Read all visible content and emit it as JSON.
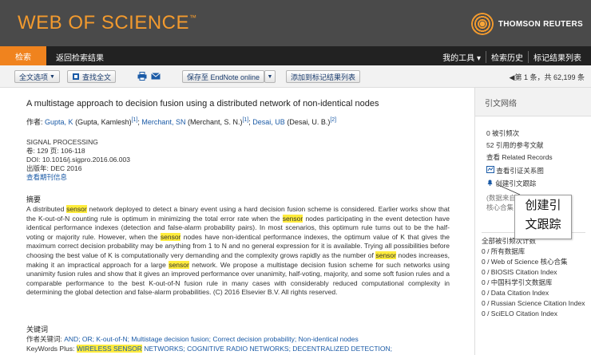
{
  "header": {
    "logo": "WEB OF SCIENCE",
    "logo_tm": "™",
    "publisher": "THOMSON REUTERS"
  },
  "nav": {
    "search": "检索",
    "back": "返回检索结果",
    "right": [
      "我的工具 ▾",
      "检索历史",
      "标记结果列表"
    ]
  },
  "toolbar": {
    "full_text_options": "全文选项",
    "find_full_text": "查找全文",
    "save_to": "保存至 EndNote online",
    "add_to_marked": "添加到标记结果列表",
    "hit_info": "◀第 1 条，共 62,199 条"
  },
  "record": {
    "title": "A multistage approach to decision fusion using a distributed network of non-identical nodes",
    "authors_label": "作者:",
    "authors": [
      {
        "link": "Gupta, K",
        "full": "(Gupta, Kamlesh)",
        "ref": "[1]"
      },
      {
        "link": "Merchant, SN",
        "full": "(Merchant, S. N.)",
        "ref": "[1]"
      },
      {
        "link": "Desai, UB",
        "full": "(Desai, U. B.)",
        "ref": "[2]"
      }
    ],
    "journal": "SIGNAL PROCESSING",
    "volume_pages": "卷: 129  页: 106-118",
    "doi": "DOI: 10.1016/j.sigpro.2016.06.003",
    "pub_date": "出版年: DEC 2016",
    "journal_info_link": "查看期刊信息",
    "abstract_heading": "摘要",
    "abstract_parts": [
      {
        "t": "A distributed "
      },
      {
        "t": "sensor",
        "h": true
      },
      {
        "t": " network deployed to detect a binary event using a hard decision fusion scheme is considered. Earlier works show that the K-out-of-N counting rule is optimum in minimizing the total error rate when the "
      },
      {
        "t": "sensor",
        "h": true
      },
      {
        "t": " nodes participating in the event detection have identical performance indexes (detection and false-alarm probability pairs). In most scenarios, this optimum rule turns out to be the half-voting or majority rule. However, when the "
      },
      {
        "t": "sensor",
        "h": true
      },
      {
        "t": " nodes have non-identical performance indexes, the optimum value of K that gives the maximum correct decision probability may be anything from 1 to N and no general expression for it is available. Trying all possibilities before choosing the best value of K is computationally very demanding and the complexity grows rapidly as the number of "
      },
      {
        "t": "sensor",
        "h": true
      },
      {
        "t": " nodes increases, making it an impractical approach for a large "
      },
      {
        "t": "sensor",
        "h": true
      },
      {
        "t": " network. We propose a multistage decision fusion scheme for such networks using unanimity fusion rules and show that it gives an improved performance over unanimity, half-voting, majority, and some soft fusion rules and a comparable performance to the best K-out-of-N fusion rule in many cases with considerably reduced computational complexity in determining the global detection and false-alarm probabilities. (C) 2016 Elsevier B.V. All rights reserved."
      }
    ],
    "keywords_heading": "关键词",
    "author_keywords_label": "作者关键词:",
    "author_keywords": "AND; OR; K-out-of-N; Multistage decision fusion; Correct decision probability; Non-identical nodes",
    "keywords_plus_label": "KeyWords Plus:",
    "keywords_plus_hl": "WIRELESS SENSOR",
    "keywords_plus_rest": " NETWORKS; COGNITIVE RADIO NETWORKS; DECENTRALIZED DETECTION;"
  },
  "sidebar": {
    "heading": "引文网络",
    "times_cited": "0 被引频次",
    "cited_refs": "52 引用的参考文献",
    "related": "查看 Related Records",
    "citation_map": "查看引证关系图",
    "create_alert": "创建引文跟踪",
    "data_from_partial": "(数据来自",
    "data_from_partial2": "核心合集",
    "all_cited": "全部被引频次计数",
    "db_counts": [
      "0 / 所有数据库",
      "0 / Web of Science 核心合集",
      "0 / BIOSIS Citation Index",
      "0 / 中国科学引文数据库",
      "0 / Data Citation Index",
      "0 / Russian Science Citation Index",
      "0 / SciELO Citation Index"
    ],
    "callout_line1": "创建引",
    "callout_line2": "文跟踪"
  }
}
